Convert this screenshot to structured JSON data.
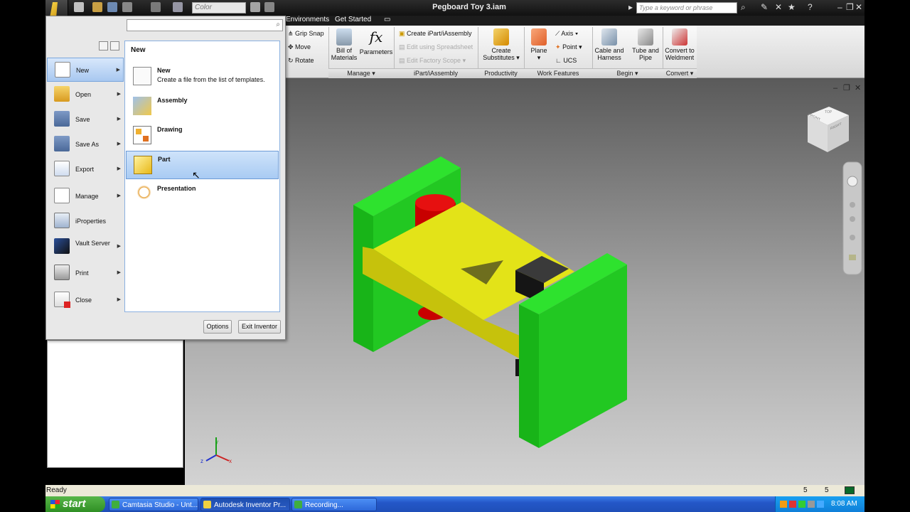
{
  "title": "Pegboard Toy 3.iam",
  "quick_access": {
    "color_combo": "Color"
  },
  "help_search": {
    "placeholder": "Type a keyword or phrase"
  },
  "ribbon": {
    "tabs": [
      "Environments",
      "Get Started"
    ],
    "manage": {
      "grip_snap": "Grip Snap",
      "move": "Move",
      "rotate": "Rotate",
      "bom": "Bill of Materials",
      "parameters": "Parameters",
      "group": "Manage"
    },
    "ipart": {
      "create": "Create iPart/iAssembly",
      "edit_spreadsheet": "Edit using Spreadsheet",
      "edit_factory": "Edit Factory Scope",
      "group": "iPart/iAssembly"
    },
    "productivity": {
      "create_substitutes": "Create Substitutes",
      "group": "Productivity"
    },
    "work_features": {
      "plane": "Plane",
      "axis": "Axis",
      "point": "Point",
      "ucs": "UCS",
      "group": "Work Features"
    },
    "begin": {
      "cable": "Cable and Harness",
      "tube": "Tube and Pipe",
      "group": "Begin"
    },
    "convert": {
      "weldment": "Convert to Weldment",
      "group": "Convert"
    }
  },
  "app_menu": {
    "items": [
      {
        "label": "New",
        "icon": "new-file-icon"
      },
      {
        "label": "Open",
        "icon": "folder-icon"
      },
      {
        "label": "Save",
        "icon": "save-icon"
      },
      {
        "label": "Save As",
        "icon": "save-as-icon"
      },
      {
        "label": "Export",
        "icon": "export-icon"
      },
      {
        "label": "Manage",
        "icon": "manage-icon"
      },
      {
        "label": "iProperties",
        "icon": "iproperties-icon"
      },
      {
        "label": "Vault Server",
        "icon": "vault-icon"
      },
      {
        "label": "Print",
        "icon": "printer-icon"
      },
      {
        "label": "Close",
        "icon": "close-file-icon"
      }
    ],
    "submenu": {
      "heading": "New",
      "entries": [
        {
          "title": "New",
          "desc": "Create a file from the list of templates."
        },
        {
          "title": "Assembly",
          "desc": ""
        },
        {
          "title": "Drawing",
          "desc": ""
        },
        {
          "title": "Part",
          "desc": ""
        },
        {
          "title": "Presentation",
          "desc": ""
        }
      ]
    },
    "options_label": "Options",
    "exit_label": "Exit Inventor"
  },
  "viewcube": {
    "front": "FRONT",
    "right": "RIGHT",
    "top": "TOP"
  },
  "status": {
    "text": "Ready",
    "count1": "5",
    "count2": "5"
  },
  "taskbar": {
    "start": "start",
    "tasks": [
      "Camtasia Studio - Unt...",
      "Autodesk Inventor Pr...",
      "Recording..."
    ],
    "clock": "8:08 AM"
  },
  "colors": {
    "green": "#1ec81e",
    "yellow": "#e3e318",
    "red": "#cc0000",
    "black": "#161616"
  }
}
